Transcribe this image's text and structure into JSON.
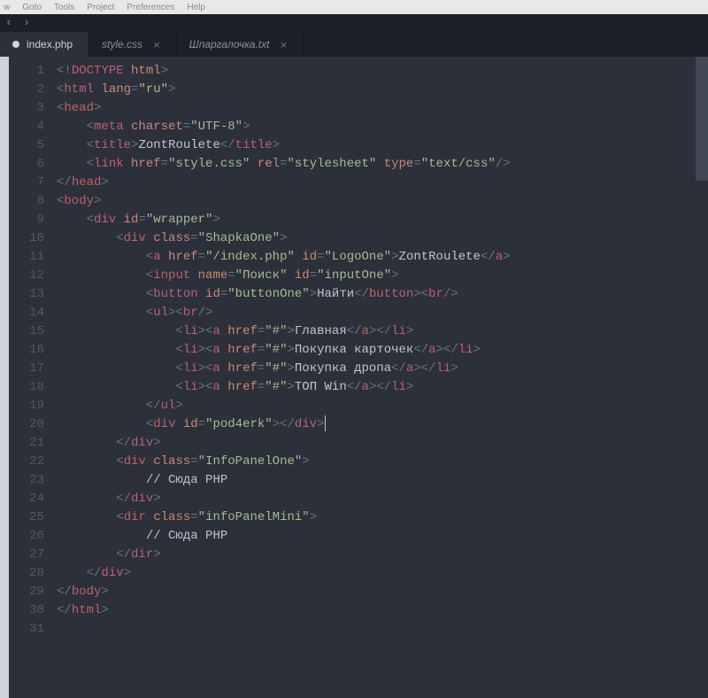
{
  "menubar": [
    "w",
    "Goto",
    "Tools",
    "Project",
    "Preferences",
    "Help"
  ],
  "tabs": [
    {
      "label": "index.php",
      "active": true,
      "badge": true,
      "close": false
    },
    {
      "label": "style.css",
      "active": false,
      "badge": false,
      "close": true
    },
    {
      "label": "Шпаргалочка.txt",
      "active": false,
      "badge": false,
      "close": true
    }
  ],
  "icons": {
    "close": "×",
    "left": "‹",
    "right": "›"
  },
  "cursor": {
    "line": 20,
    "after": "pod4erk\"></div>"
  },
  "code": [
    [
      {
        "cls": "t-punc",
        "t": "<!"
      },
      {
        "cls": "t-tag",
        "t": "DOCTYPE"
      },
      {
        "cls": "t-attr",
        "t": " html"
      },
      {
        "cls": "t-punc",
        "t": ">"
      }
    ],
    [
      {
        "cls": "t-punc",
        "t": "<"
      },
      {
        "cls": "t-tag",
        "t": "html"
      },
      {
        "cls": "t-attr",
        "t": " lang"
      },
      {
        "cls": "t-punc",
        "t": "="
      },
      {
        "cls": "t-str",
        "t": "\"ru\""
      },
      {
        "cls": "t-punc",
        "t": ">"
      }
    ],
    [
      {
        "cls": "t-punc",
        "t": "<"
      },
      {
        "cls": "t-tag",
        "t": "head"
      },
      {
        "cls": "t-punc",
        "t": ">"
      }
    ],
    [
      {
        "cls": "",
        "t": "    "
      },
      {
        "cls": "t-punc",
        "t": "<"
      },
      {
        "cls": "t-tag",
        "t": "meta"
      },
      {
        "cls": "t-attr",
        "t": " charset"
      },
      {
        "cls": "t-punc",
        "t": "="
      },
      {
        "cls": "t-str",
        "t": "\"UTF-8\""
      },
      {
        "cls": "t-punc",
        "t": ">"
      }
    ],
    [
      {
        "cls": "",
        "t": "    "
      },
      {
        "cls": "t-punc",
        "t": "<"
      },
      {
        "cls": "t-tag",
        "t": "title"
      },
      {
        "cls": "t-punc",
        "t": ">"
      },
      {
        "cls": "t-text",
        "t": "ZontRoulete"
      },
      {
        "cls": "t-punc",
        "t": "</"
      },
      {
        "cls": "t-tag",
        "t": "title"
      },
      {
        "cls": "t-punc",
        "t": ">"
      }
    ],
    [
      {
        "cls": "",
        "t": "    "
      },
      {
        "cls": "t-punc",
        "t": "<"
      },
      {
        "cls": "t-tag",
        "t": "link"
      },
      {
        "cls": "t-attr",
        "t": " href"
      },
      {
        "cls": "t-punc",
        "t": "="
      },
      {
        "cls": "t-str",
        "t": "\"style.css\""
      },
      {
        "cls": "t-attr",
        "t": " rel"
      },
      {
        "cls": "t-punc",
        "t": "="
      },
      {
        "cls": "t-str",
        "t": "\"stylesheet\""
      },
      {
        "cls": "t-attr",
        "t": " type"
      },
      {
        "cls": "t-punc",
        "t": "="
      },
      {
        "cls": "t-str",
        "t": "\"text/css\""
      },
      {
        "cls": "t-punc",
        "t": "/>"
      }
    ],
    [
      {
        "cls": "t-punc",
        "t": "</"
      },
      {
        "cls": "t-tag",
        "t": "head"
      },
      {
        "cls": "t-punc",
        "t": ">"
      }
    ],
    [
      {
        "cls": "t-punc",
        "t": "<"
      },
      {
        "cls": "t-tag",
        "t": "body"
      },
      {
        "cls": "t-punc",
        "t": ">"
      }
    ],
    [
      {
        "cls": "",
        "t": "    "
      },
      {
        "cls": "t-punc",
        "t": "<"
      },
      {
        "cls": "t-tag",
        "t": "div"
      },
      {
        "cls": "t-attr",
        "t": " id"
      },
      {
        "cls": "t-punc",
        "t": "="
      },
      {
        "cls": "t-str",
        "t": "\"wrapper\""
      },
      {
        "cls": "t-punc",
        "t": ">"
      }
    ],
    [
      {
        "cls": "",
        "t": "        "
      },
      {
        "cls": "t-punc",
        "t": "<"
      },
      {
        "cls": "t-tag",
        "t": "div"
      },
      {
        "cls": "t-attr",
        "t": " class"
      },
      {
        "cls": "t-punc",
        "t": "="
      },
      {
        "cls": "t-str",
        "t": "\"ShapkaOne\""
      },
      {
        "cls": "t-punc",
        "t": ">"
      }
    ],
    [
      {
        "cls": "",
        "t": "            "
      },
      {
        "cls": "t-punc",
        "t": "<"
      },
      {
        "cls": "t-tag",
        "t": "a"
      },
      {
        "cls": "t-attr",
        "t": " href"
      },
      {
        "cls": "t-punc",
        "t": "="
      },
      {
        "cls": "t-str",
        "t": "\"/index.php\""
      },
      {
        "cls": "t-attr",
        "t": " id"
      },
      {
        "cls": "t-punc",
        "t": "="
      },
      {
        "cls": "t-str",
        "t": "\"LogoOne\""
      },
      {
        "cls": "t-punc",
        "t": ">"
      },
      {
        "cls": "t-text",
        "t": "ZontRoulete"
      },
      {
        "cls": "t-punc",
        "t": "</"
      },
      {
        "cls": "t-tag",
        "t": "a"
      },
      {
        "cls": "t-punc",
        "t": ">"
      }
    ],
    [
      {
        "cls": "",
        "t": "            "
      },
      {
        "cls": "t-punc",
        "t": "<"
      },
      {
        "cls": "t-tag",
        "t": "input"
      },
      {
        "cls": "t-attr",
        "t": " name"
      },
      {
        "cls": "t-punc",
        "t": "="
      },
      {
        "cls": "t-str",
        "t": "\"Поиск\""
      },
      {
        "cls": "t-attr",
        "t": " id"
      },
      {
        "cls": "t-punc",
        "t": "="
      },
      {
        "cls": "t-str",
        "t": "\"inputOne\""
      },
      {
        "cls": "t-punc",
        "t": ">"
      }
    ],
    [
      {
        "cls": "",
        "t": "            "
      },
      {
        "cls": "t-punc",
        "t": "<"
      },
      {
        "cls": "t-tag",
        "t": "button"
      },
      {
        "cls": "t-attr",
        "t": " id"
      },
      {
        "cls": "t-punc",
        "t": "="
      },
      {
        "cls": "t-str",
        "t": "\"buttonOne\""
      },
      {
        "cls": "t-punc",
        "t": ">"
      },
      {
        "cls": "t-text",
        "t": "Найти"
      },
      {
        "cls": "t-punc",
        "t": "</"
      },
      {
        "cls": "t-tag",
        "t": "button"
      },
      {
        "cls": "t-punc",
        "t": "><"
      },
      {
        "cls": "t-tag",
        "t": "br"
      },
      {
        "cls": "t-punc",
        "t": "/>"
      }
    ],
    [
      {
        "cls": "",
        "t": "            "
      },
      {
        "cls": "t-punc",
        "t": "<"
      },
      {
        "cls": "t-tag",
        "t": "ul"
      },
      {
        "cls": "t-punc",
        "t": "><"
      },
      {
        "cls": "t-tag",
        "t": "br"
      },
      {
        "cls": "t-punc",
        "t": "/>"
      }
    ],
    [
      {
        "cls": "",
        "t": "                "
      },
      {
        "cls": "t-punc",
        "t": "<"
      },
      {
        "cls": "t-tag",
        "t": "li"
      },
      {
        "cls": "t-punc",
        "t": "><"
      },
      {
        "cls": "t-tag",
        "t": "a"
      },
      {
        "cls": "t-attr",
        "t": " href"
      },
      {
        "cls": "t-punc",
        "t": "="
      },
      {
        "cls": "t-str",
        "t": "\"#\""
      },
      {
        "cls": "t-punc",
        "t": ">"
      },
      {
        "cls": "t-text",
        "t": "Главная"
      },
      {
        "cls": "t-punc",
        "t": "</"
      },
      {
        "cls": "t-tag",
        "t": "a"
      },
      {
        "cls": "t-punc",
        "t": "></"
      },
      {
        "cls": "t-tag",
        "t": "li"
      },
      {
        "cls": "t-punc",
        "t": ">"
      }
    ],
    [
      {
        "cls": "",
        "t": "                "
      },
      {
        "cls": "t-punc",
        "t": "<"
      },
      {
        "cls": "t-tag",
        "t": "li"
      },
      {
        "cls": "t-punc",
        "t": "><"
      },
      {
        "cls": "t-tag",
        "t": "a"
      },
      {
        "cls": "t-attr",
        "t": " href"
      },
      {
        "cls": "t-punc",
        "t": "="
      },
      {
        "cls": "t-str",
        "t": "\"#\""
      },
      {
        "cls": "t-punc",
        "t": ">"
      },
      {
        "cls": "t-text",
        "t": "Покупка карточек"
      },
      {
        "cls": "t-punc",
        "t": "</"
      },
      {
        "cls": "t-tag",
        "t": "a"
      },
      {
        "cls": "t-punc",
        "t": "></"
      },
      {
        "cls": "t-tag",
        "t": "li"
      },
      {
        "cls": "t-punc",
        "t": ">"
      }
    ],
    [
      {
        "cls": "",
        "t": "                "
      },
      {
        "cls": "t-punc",
        "t": "<"
      },
      {
        "cls": "t-tag",
        "t": "li"
      },
      {
        "cls": "t-punc",
        "t": "><"
      },
      {
        "cls": "t-tag",
        "t": "a"
      },
      {
        "cls": "t-attr",
        "t": " href"
      },
      {
        "cls": "t-punc",
        "t": "="
      },
      {
        "cls": "t-str",
        "t": "\"#\""
      },
      {
        "cls": "t-punc",
        "t": ">"
      },
      {
        "cls": "t-text",
        "t": "Покупка дропа"
      },
      {
        "cls": "t-punc",
        "t": "</"
      },
      {
        "cls": "t-tag",
        "t": "a"
      },
      {
        "cls": "t-punc",
        "t": "></"
      },
      {
        "cls": "t-tag",
        "t": "li"
      },
      {
        "cls": "t-punc",
        "t": ">"
      }
    ],
    [
      {
        "cls": "",
        "t": "                "
      },
      {
        "cls": "t-punc",
        "t": "<"
      },
      {
        "cls": "t-tag",
        "t": "li"
      },
      {
        "cls": "t-punc",
        "t": "><"
      },
      {
        "cls": "t-tag",
        "t": "a"
      },
      {
        "cls": "t-attr",
        "t": " href"
      },
      {
        "cls": "t-punc",
        "t": "="
      },
      {
        "cls": "t-str",
        "t": "\"#\""
      },
      {
        "cls": "t-punc",
        "t": ">"
      },
      {
        "cls": "t-text",
        "t": "ТОП Win"
      },
      {
        "cls": "t-punc",
        "t": "</"
      },
      {
        "cls": "t-tag",
        "t": "a"
      },
      {
        "cls": "t-punc",
        "t": "></"
      },
      {
        "cls": "t-tag",
        "t": "li"
      },
      {
        "cls": "t-punc",
        "t": ">"
      }
    ],
    [
      {
        "cls": "",
        "t": "            "
      },
      {
        "cls": "t-punc",
        "t": "</"
      },
      {
        "cls": "t-tag",
        "t": "ul"
      },
      {
        "cls": "t-punc",
        "t": ">"
      }
    ],
    [
      {
        "cls": "",
        "t": "            "
      },
      {
        "cls": "t-punc",
        "t": "<"
      },
      {
        "cls": "t-tag",
        "t": "div"
      },
      {
        "cls": "t-attr",
        "t": " id"
      },
      {
        "cls": "t-punc",
        "t": "="
      },
      {
        "cls": "t-str",
        "t": "\"pod4erk\""
      },
      {
        "cls": "t-punc",
        "t": "></"
      },
      {
        "cls": "t-tag",
        "t": "div"
      },
      {
        "cls": "t-punc",
        "t": ">"
      }
    ],
    [
      {
        "cls": "",
        "t": "        "
      },
      {
        "cls": "t-punc",
        "t": "</"
      },
      {
        "cls": "t-tag",
        "t": "div"
      },
      {
        "cls": "t-punc",
        "t": ">"
      }
    ],
    [
      {
        "cls": "",
        "t": "        "
      },
      {
        "cls": "t-punc",
        "t": "<"
      },
      {
        "cls": "t-tag",
        "t": "div"
      },
      {
        "cls": "t-attr",
        "t": " class"
      },
      {
        "cls": "t-punc",
        "t": "="
      },
      {
        "cls": "t-str",
        "t": "\"InfoPanelOne\""
      },
      {
        "cls": "t-punc",
        "t": ">"
      }
    ],
    [
      {
        "cls": "",
        "t": "            "
      },
      {
        "cls": "t-text",
        "t": "// Сюда PHP"
      }
    ],
    [
      {
        "cls": "",
        "t": "        "
      },
      {
        "cls": "t-punc",
        "t": "</"
      },
      {
        "cls": "t-tag",
        "t": "div"
      },
      {
        "cls": "t-punc",
        "t": ">"
      }
    ],
    [
      {
        "cls": "",
        "t": "        "
      },
      {
        "cls": "t-punc",
        "t": "<"
      },
      {
        "cls": "t-tag",
        "t": "dir"
      },
      {
        "cls": "t-attr",
        "t": " class"
      },
      {
        "cls": "t-punc",
        "t": "="
      },
      {
        "cls": "t-str",
        "t": "\"infoPanelMini\""
      },
      {
        "cls": "t-punc",
        "t": ">"
      }
    ],
    [
      {
        "cls": "",
        "t": "            "
      },
      {
        "cls": "t-text",
        "t": "// Сюда PHP"
      }
    ],
    [
      {
        "cls": "",
        "t": "        "
      },
      {
        "cls": "t-punc",
        "t": "</"
      },
      {
        "cls": "t-tag",
        "t": "dir"
      },
      {
        "cls": "t-punc",
        "t": ">"
      }
    ],
    [
      {
        "cls": "",
        "t": "    "
      },
      {
        "cls": "t-punc",
        "t": "</"
      },
      {
        "cls": "t-tag",
        "t": "div"
      },
      {
        "cls": "t-punc",
        "t": ">"
      }
    ],
    [
      {
        "cls": "t-punc",
        "t": "</"
      },
      {
        "cls": "t-tag",
        "t": "body"
      },
      {
        "cls": "t-punc",
        "t": ">"
      }
    ],
    [
      {
        "cls": "t-punc",
        "t": "</"
      },
      {
        "cls": "t-tag",
        "t": "html"
      },
      {
        "cls": "t-punc",
        "t": ">"
      }
    ],
    [
      {
        "cls": "",
        "t": ""
      }
    ]
  ]
}
